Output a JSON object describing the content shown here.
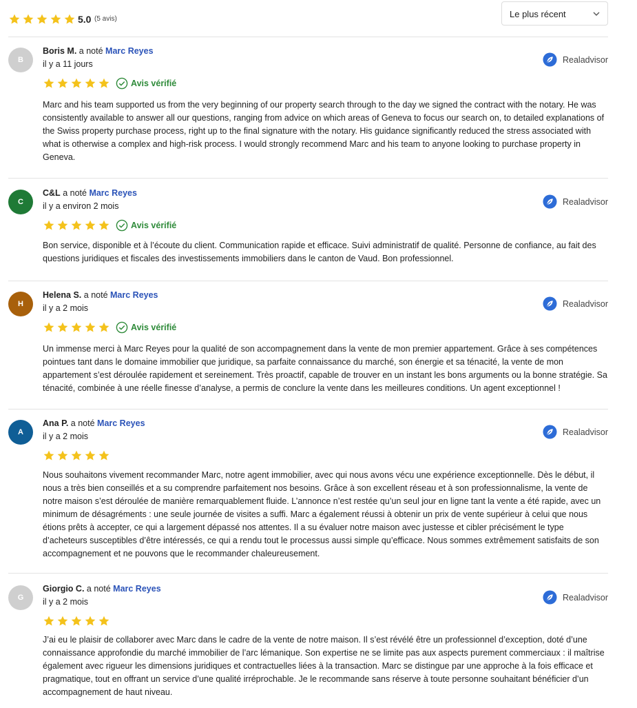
{
  "summary": {
    "score": "5.0",
    "count": "(5 avis)",
    "stars": 5
  },
  "sort": {
    "label": "Le plus récent"
  },
  "common": {
    "rated_text": "a noté",
    "verified_label": "Avis vérifié",
    "source_label": "Realadvisor"
  },
  "colors": {
    "star": "#f4c21b",
    "agent_link": "#2b53b8",
    "verified": "#2f8b3a",
    "logo": "#2d6cd7"
  },
  "reviews": [
    {
      "initial": "B",
      "avatar_color": "#cfcfcf",
      "name": "Boris M.",
      "agent": "Marc Reyes",
      "date": "il y a 11 jours",
      "verified": true,
      "text": "Marc and his team supported us from the very beginning of our property search through to the day we signed the contract with the notary. He was consistently available to answer all our questions, ranging from advice on which areas of Geneva to focus our search on, to detailed explanations of the Swiss property purchase process, right up to the final signature with the notary. His guidance significantly reduced the stress associated with what is otherwise a complex and high-risk process. I would strongly recommend Marc and his team to anyone looking to purchase property in Geneva."
    },
    {
      "initial": "C",
      "avatar_color": "#1f7a36",
      "name": "C&L",
      "agent": "Marc Reyes",
      "date": "il y a environ 2 mois",
      "verified": true,
      "text": "Bon service, disponible et à l’écoute du client. Communication rapide et efficace. Suivi administratif de qualité. Personne de confiance, au fait des questions juridiques et fiscales des investissements immobiliers dans le canton de Vaud. Bon professionnel."
    },
    {
      "initial": "H",
      "avatar_color": "#a8600b",
      "name": "Helena S.",
      "agent": "Marc Reyes",
      "date": "il y a 2 mois",
      "verified": true,
      "text": "Un immense merci à Marc Reyes pour la qualité de son accompagnement dans la vente de mon premier appartement. Grâce à ses compétences pointues tant dans le domaine immobilier que juridique, sa parfaite connaissance du marché, son énergie et sa ténacité, la vente de mon appartement s’est déroulée rapidement et sereinement. Très proactif, capable de trouver en un instant les bons arguments ou la bonne stratégie. Sa ténacité, combinée à une réelle finesse d’analyse, a permis de conclure la vente dans les meilleures conditions. Un agent exceptionnel !"
    },
    {
      "initial": "A",
      "avatar_color": "#0f5e96",
      "name": "Ana P.",
      "agent": "Marc Reyes",
      "date": "il y a 2 mois",
      "verified": false,
      "text": "Nous souhaitons vivement recommander Marc, notre agent immobilier, avec qui nous avons vécu une expérience exceptionnelle. Dès le début, il nous a très bien conseillés et a su comprendre parfaitement nos besoins. Grâce à son excellent réseau et à son professionnalisme, la vente de notre maison s’est déroulée de manière remarquablement fluide. L’annonce n’est restée qu’un seul jour en ligne tant la vente a été rapide, avec un minimum de désagréments : une seule journée de visites a suffi. Marc a également réussi à obtenir un prix de vente supérieur à celui que nous étions prêts à accepter, ce qui a largement dépassé nos attentes. Il a su évaluer notre maison avec justesse et cibler précisément le type d’acheteurs susceptibles d’être intéressés, ce qui a rendu tout le processus aussi simple qu’efficace. Nous sommes extrêmement satisfaits de son accompagnement et ne pouvons que le recommander chaleureusement."
    },
    {
      "initial": "G",
      "avatar_color": "#cfcfcf",
      "name": "Giorgio C.",
      "agent": "Marc Reyes",
      "date": "il y a 2 mois",
      "verified": false,
      "text": "J’ai eu le plaisir de collaborer avec Marc dans le cadre de la vente de notre maison. Il s’est révélé être un professionnel d’exception, doté d’une connaissance approfondie du marché immobilier de l’arc lémanique. Son expertise ne se limite pas aux aspects purement commerciaux : il maîtrise également avec rigueur les dimensions juridiques et contractuelles liées à la transaction. Marc se distingue par une approche à la fois efficace et pragmatique, tout en offrant un service d’une qualité irréprochable. Je le recommande sans réserve à toute personne souhaitant bénéficier d’un accompagnement de haut niveau."
    }
  ]
}
